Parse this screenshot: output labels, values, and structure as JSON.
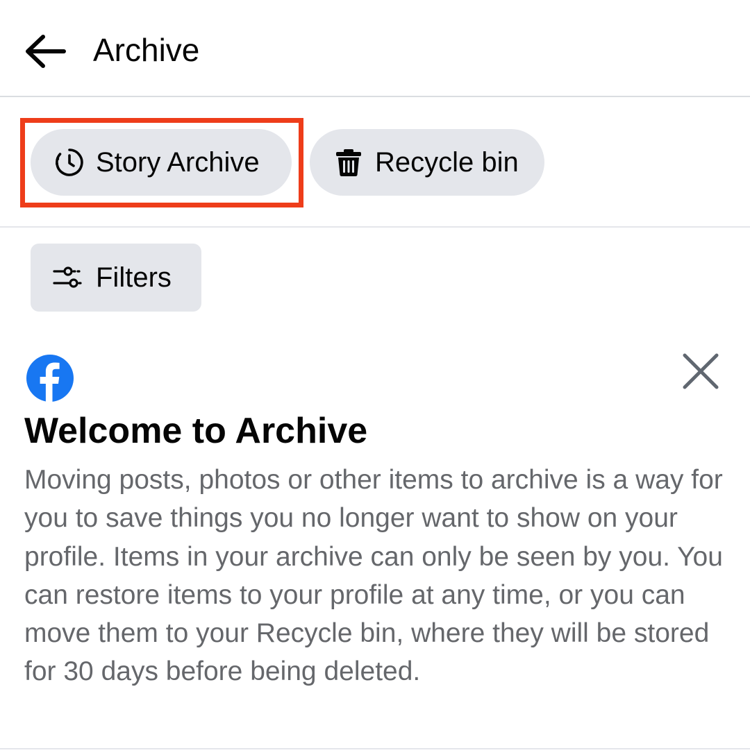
{
  "header": {
    "title": "Archive",
    "back_icon": "back-arrow-icon"
  },
  "tabs": [
    {
      "label": "Story Archive",
      "icon": "story-clock-icon",
      "highlighted": true
    },
    {
      "label": "Recycle bin",
      "icon": "trash-bin-icon",
      "highlighted": false
    }
  ],
  "filters": {
    "label": "Filters",
    "icon": "sliders-icon"
  },
  "welcome": {
    "logo": "facebook-logo-icon",
    "title": "Welcome to Archive",
    "body": "Moving posts, photos or other items to archive is a way for you to save things you no longer want to show on your profile. Items in your archive can only be seen by you. You can restore items to your profile at any time, or you can move them to your Recycle bin, where they will be stored for 30 days before being deleted.",
    "close_icon": "close-icon"
  },
  "colors": {
    "chip_background": "#e4e6eb",
    "highlight_border": "#ee3d1a",
    "facebook_blue": "#1877f2",
    "body_text": "#65676b"
  }
}
